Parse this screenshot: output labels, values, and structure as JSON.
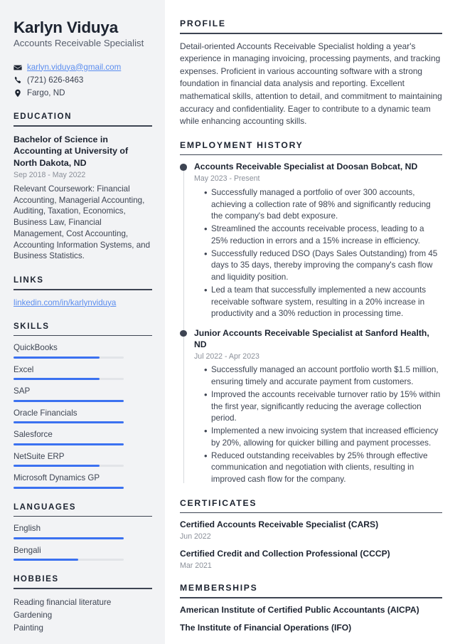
{
  "theme": {
    "sidebar_bg": "#f2f3f5",
    "page_bg": "#ffffff",
    "heading_color": "#1c2330",
    "body_color": "#3d4452",
    "muted_color": "#8a8f99",
    "accent_blue": "#3b71f0",
    "link_blue": "#5b8def",
    "bar_track": "#e2e4e8"
  },
  "header": {
    "name": "Karlyn Viduya",
    "job_title": "Accounts Receivable Specialist",
    "contacts": [
      {
        "icon": "envelope-icon",
        "text": "karlyn.viduya@gmail.com",
        "is_link": true
      },
      {
        "icon": "phone-icon",
        "text": "(721) 626-8463",
        "is_link": false
      },
      {
        "icon": "location-pin-icon",
        "text": "Fargo, ND",
        "is_link": false
      }
    ]
  },
  "sidebar": {
    "education": {
      "heading": "EDUCATION",
      "degree": "Bachelor of Science in Accounting at University of North Dakota, ND",
      "date": "Sep 2018 - May 2022",
      "description": "Relevant Coursework: Financial Accounting, Managerial Accounting, Auditing, Taxation, Economics, Business Law, Financial Management, Cost Accounting, Accounting Information Systems, and Business Statistics."
    },
    "links": {
      "heading": "LINKS",
      "items": [
        {
          "label": "linkedin.com/in/karlynviduya"
        }
      ]
    },
    "skills": {
      "heading": "SKILLS",
      "items": [
        {
          "label": "QuickBooks",
          "level": 78
        },
        {
          "label": "Excel",
          "level": 78
        },
        {
          "label": "SAP",
          "level": 100
        },
        {
          "label": "Oracle Financials",
          "level": 100
        },
        {
          "label": "Salesforce",
          "level": 100
        },
        {
          "label": "NetSuite ERP",
          "level": 78
        },
        {
          "label": "Microsoft Dynamics GP",
          "level": 100
        }
      ]
    },
    "languages": {
      "heading": "LANGUAGES",
      "items": [
        {
          "label": "English",
          "level": 100
        },
        {
          "label": "Bengali",
          "level": 59
        }
      ]
    },
    "hobbies": {
      "heading": "HOBBIES",
      "items": [
        {
          "label": "Reading financial literature"
        },
        {
          "label": "Gardening"
        },
        {
          "label": "Painting"
        }
      ]
    }
  },
  "main": {
    "profile": {
      "heading": "PROFILE",
      "text": "Detail-oriented Accounts Receivable Specialist holding a year's experience in managing invoicing, processing payments, and tracking expenses. Proficient in various accounting software with a strong foundation in financial data analysis and reporting. Excellent mathematical skills, attention to detail, and commitment to maintaining accuracy and confidentiality. Eager to contribute to a dynamic team while enhancing accounting skills."
    },
    "employment": {
      "heading": "EMPLOYMENT HISTORY",
      "entries": [
        {
          "title": "Accounts Receivable Specialist at Doosan Bobcat, ND",
          "date": "May 2023 - Present",
          "bullets": [
            "Successfully managed a portfolio of over 300 accounts, achieving a collection rate of 98% and significantly reducing the company's bad debt exposure.",
            "Streamlined the accounts receivable process, leading to a 25% reduction in errors and a 15% increase in efficiency.",
            "Successfully reduced DSO (Days Sales Outstanding) from 45 days to 35 days, thereby improving the company's cash flow and liquidity position.",
            "Led a team that successfully implemented a new accounts receivable software system, resulting in a 20% increase in productivity and a 30% reduction in processing time."
          ]
        },
        {
          "title": "Junior Accounts Receivable Specialist at Sanford Health, ND",
          "date": "Jul 2022 - Apr 2023",
          "bullets": [
            "Successfully managed an account portfolio worth $1.5 million, ensuring timely and accurate payment from customers.",
            "Improved the accounts receivable turnover ratio by 15% within the first year, significantly reducing the average collection period.",
            "Implemented a new invoicing system that increased efficiency by 20%, allowing for quicker billing and payment processes.",
            "Reduced outstanding receivables by 25% through effective communication and negotiation with clients, resulting in improved cash flow for the company."
          ]
        }
      ]
    },
    "certificates": {
      "heading": "CERTIFICATES",
      "items": [
        {
          "name": "Certified Accounts Receivable Specialist (CARS)",
          "date": "Jun 2022"
        },
        {
          "name": "Certified Credit and Collection Professional (CCCP)",
          "date": "Mar 2021"
        }
      ]
    },
    "memberships": {
      "heading": "MEMBERSHIPS",
      "items": [
        {
          "name": "American Institute of Certified Public Accountants (AICPA)"
        },
        {
          "name": "The Institute of Financial Operations (IFO)"
        }
      ]
    }
  }
}
